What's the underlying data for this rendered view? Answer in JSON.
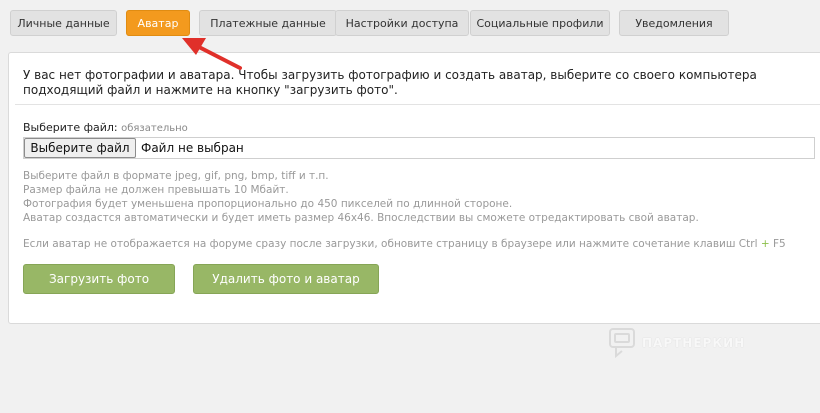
{
  "tabs": [
    {
      "label": "Личные данные"
    },
    {
      "label": "Аватар"
    },
    {
      "label": "Платежные данные"
    },
    {
      "label": "Настройки доступа"
    },
    {
      "label": "Социальные профили"
    },
    {
      "label": "Уведомления"
    }
  ],
  "intro": {
    "text": "У вас нет фотографии и аватара. Чтобы загрузить фотографию и создать аватар, выберите со своего компьютера подходящий файл и нажмите на кнопку \"загрузить фото\"."
  },
  "file_field": {
    "label": "Выберите файл:",
    "required_note": "обязательно",
    "button_label": "Выберите файл",
    "status": "Файл не выбран"
  },
  "hints": [
    "Выберите файл в формате jpeg, gif, png, bmp, tiff и т.п.",
    "Размер файла не должен превышать 10 Мбайт.",
    "Фотография будет уменьшена пропорционально до 450 пикселей по длинной стороне.",
    "Аватар создастся автоматически и будет иметь размер 46x46. Впоследствии вы сможете отредактировать свой аватар."
  ],
  "note": {
    "text": "Если аватар не отображается на форуме сразу после загрузки, обновите страницу в браузере или нажмите сочетание клавиш Ctrl",
    "plus": "+",
    "key": "F5"
  },
  "buttons": {
    "upload": "Загрузить фото",
    "delete": "Удалить фото и аватар"
  },
  "watermark": {
    "text": "ПАРТНЕРКИН"
  },
  "colors": {
    "active_tab": "#f39a1e",
    "button_green": "#98b766",
    "arrow_red": "#e0302a"
  }
}
